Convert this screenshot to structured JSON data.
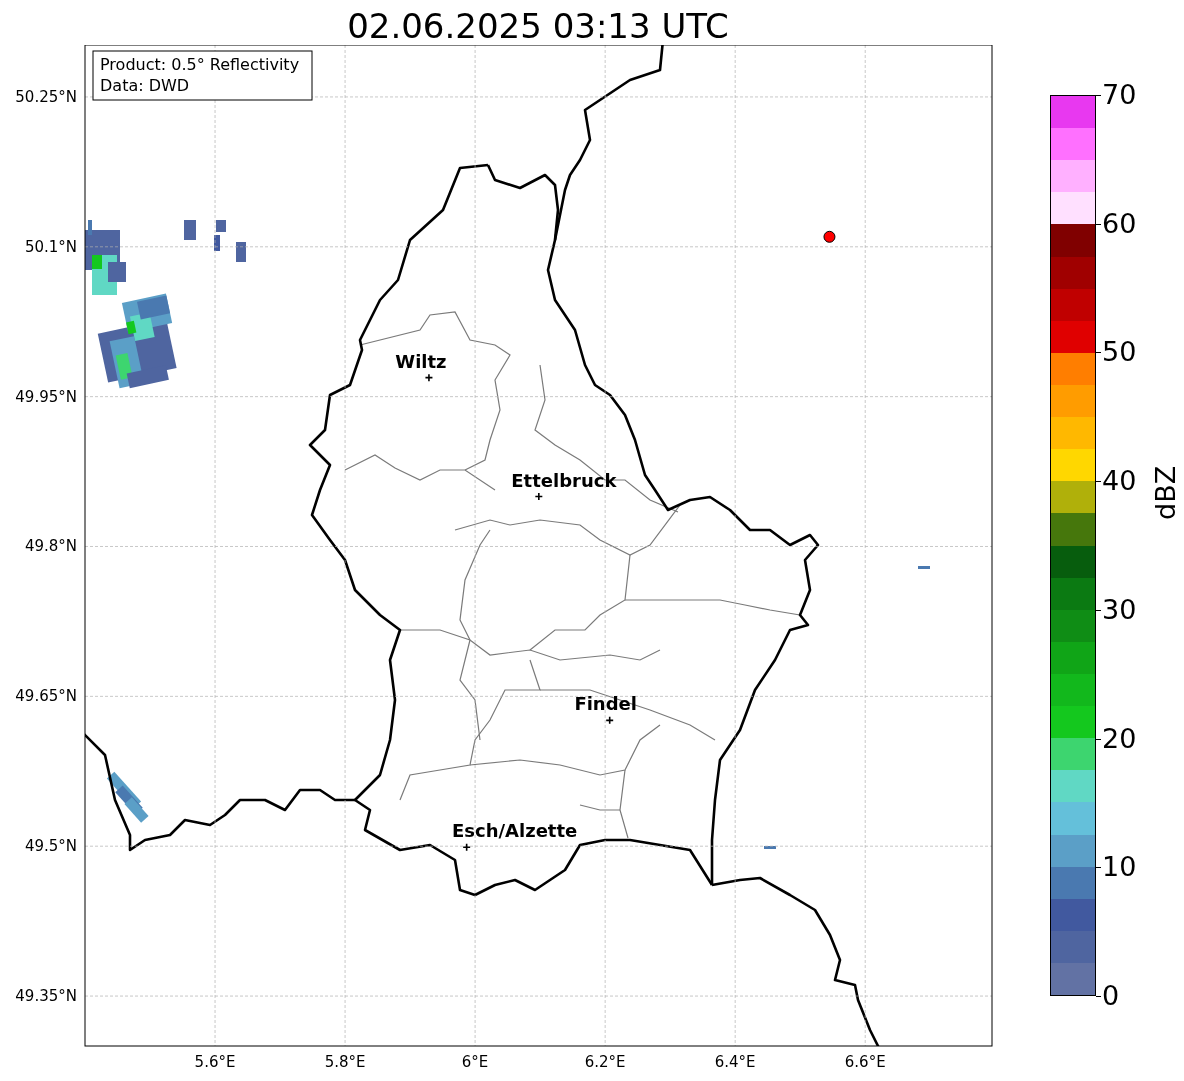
{
  "title": "02.06.2025 03:13 UTC",
  "info_box": [
    "Product: 0.5° Reflectivity",
    "Data: DWD"
  ],
  "map": {
    "chart_data": {
      "type": "scatter",
      "grid": true,
      "xlim": [
        5.4,
        6.795
      ],
      "ylim": [
        49.3,
        50.302
      ],
      "xticks": [
        {
          "value": 5.6,
          "label": "5.6°E"
        },
        {
          "value": 5.8,
          "label": "5.8°E"
        },
        {
          "value": 6.0,
          "label": "6°E"
        },
        {
          "value": 6.2,
          "label": "6.2°E"
        },
        {
          "value": 6.4,
          "label": "6.4°E"
        },
        {
          "value": 6.6,
          "label": "6.6°E"
        }
      ],
      "yticks": [
        {
          "value": 49.35,
          "label": "49.35°N"
        },
        {
          "value": 49.5,
          "label": "49.5°N"
        },
        {
          "value": 49.65,
          "label": "49.65°N"
        },
        {
          "value": 49.8,
          "label": "49.8°N"
        },
        {
          "value": 49.95,
          "label": "49.95°N"
        },
        {
          "value": 50.1,
          "label": "50.1°N"
        },
        {
          "value": 50.25,
          "label": "50.25°N"
        }
      ],
      "x": [
        5.929,
        6.098,
        6.207,
        5.987,
        6.545
      ],
      "series": [
        {
          "color": "#000000",
          "values": [
            49.969,
            49.85,
            49.626,
            49.499,
            null
          ]
        },
        {
          "color": "#ff0000",
          "values": [
            null,
            null,
            null,
            null,
            50.11
          ]
        }
      ],
      "annotations": [
        "Wiltz",
        "Ettelbruck",
        "Findel",
        "Esch/Alzette"
      ]
    }
  },
  "colorbar": {
    "label": "dBZ",
    "ticks": [
      "70",
      "60",
      "50",
      "40",
      "30",
      "20",
      "10",
      "0"
    ],
    "segments": [
      {
        "color": "#e838f0"
      },
      {
        "color": "#ff70ff"
      },
      {
        "color": "#ffb0ff"
      },
      {
        "color": "#ffe0ff"
      },
      {
        "color": "#800000"
      },
      {
        "color": "#a00000"
      },
      {
        "color": "#c00000"
      },
      {
        "color": "#e00000"
      },
      {
        "color": "#ff7e00"
      },
      {
        "color": "#ff9c00"
      },
      {
        "color": "#ffb800"
      },
      {
        "color": "#ffd700"
      },
      {
        "color": "#b0b00a"
      },
      {
        "color": "#46770c"
      },
      {
        "color": "#075d0d"
      },
      {
        "color": "#0b7a12"
      },
      {
        "color": "#0f8d15"
      },
      {
        "color": "#10a517"
      },
      {
        "color": "#12b81c"
      },
      {
        "color": "#14c81e"
      },
      {
        "color": "#3dd56f"
      },
      {
        "color": "#60d8c4"
      },
      {
        "color": "#64c0da"
      },
      {
        "color": "#5b9fc7"
      },
      {
        "color": "#4a79b0"
      },
      {
        "color": "#41599f"
      },
      {
        "color": "#4f65a0"
      },
      {
        "color": "#6272a4"
      }
    ]
  }
}
